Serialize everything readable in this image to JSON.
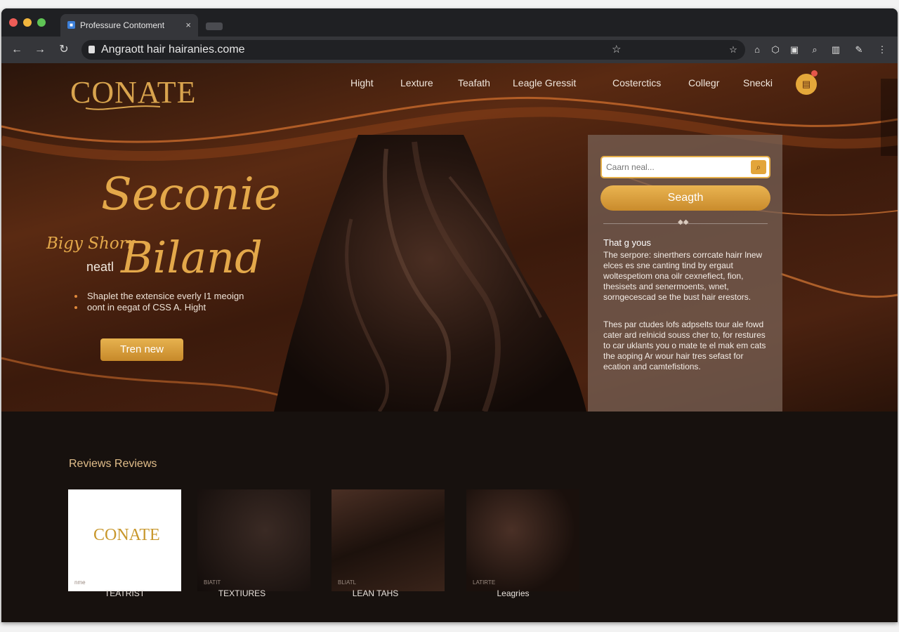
{
  "browser": {
    "tab_title": "Professure Contoment",
    "tab_close": "×",
    "url": "Angraott hair hairanies.come",
    "controls": {
      "back": "←",
      "forward": "→",
      "reload": "↻"
    },
    "toolbar_icons": [
      "star-icon",
      "extension-icon",
      "shield-icon",
      "cart-icon",
      "search-icon",
      "chart-icon",
      "edit-icon",
      "menu-icon"
    ]
  },
  "site": {
    "logo": "CONATE",
    "nav": [
      "Hight",
      "Lexture",
      "Teafath",
      "Leagle Gressit",
      "Costerctics",
      "Collegr",
      "Snecki"
    ],
    "hero": {
      "line1": "Seconie",
      "line2_script": "Bigy Shorr",
      "line2_word": "neatl",
      "line3": "Biland",
      "bullets": [
        "Shaplet the extensice everly I1 meoign",
        "oont in eegat of CSS A. Hight"
      ],
      "cta": "Tren new"
    },
    "panel": {
      "search_placeholder": "Caarn neal...",
      "search_button": "Seagth",
      "heading": "That g yous",
      "body1": "The serpore: sinerthers corrcate hairr lnew elces es sne canting tind by ergaut woltespetiom ona oilr cexnefiect, fion, thesisets and senermoents, wnet, sorngecescad se the bust hair erestors.",
      "body2": "Thes par ctudes lofs adpselts tour ale fowd cater ard relnicid souss cher to, for restures to car uklants you o mate te el mak em cats the aoping Ar wour hair tres sefast for ecation and camtefistions."
    },
    "reviews": {
      "title": "Reviews Reviews",
      "cards": [
        {
          "label": "TEATRIST",
          "mini": "nme",
          "logo": "CONATE"
        },
        {
          "label": "TEXTIURES",
          "mini": "BIATIT"
        },
        {
          "label": "LEAN TAHS",
          "mini": "BLIATL"
        },
        {
          "label": "Leagries",
          "mini": "LATIRTE"
        }
      ]
    }
  },
  "colors": {
    "accent_gold": "#e3a84a",
    "panel": "#786256",
    "dark_bg": "#17110e"
  }
}
